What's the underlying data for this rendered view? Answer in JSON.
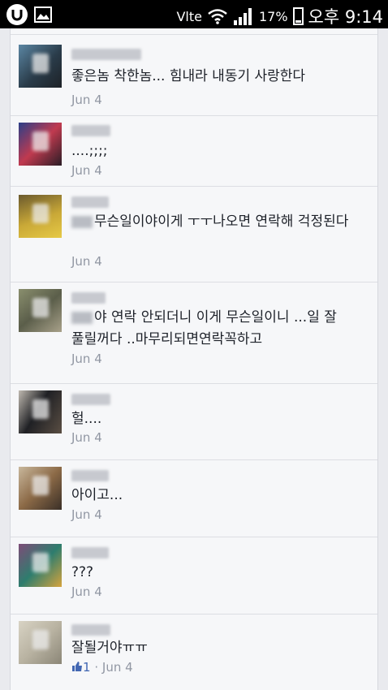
{
  "status_bar": {
    "network": "Vlte",
    "battery_percent": "17%",
    "time": "오후 9:14",
    "icons": [
      "u-plus-app-icon",
      "gallery-icon",
      "wifi-icon",
      "signal-icon",
      "battery-icon"
    ]
  },
  "comments": [
    {
      "text": "좋은놈 착한놈... 힘내라 내동기 사랑한다",
      "date": "Jun 4"
    },
    {
      "text": "....;;;;",
      "date": "Jun 4"
    },
    {
      "text": "무슨일이야이게 ㅜㅜ나오면 연락해 걱정된다",
      "date": "Jun 4"
    },
    {
      "text": "야 연락 안되더니 이게 무슨일이니 ...일 잘 풀릴꺼다 ..마무리되면연락꼭하고",
      "date": "Jun 4"
    },
    {
      "text": "헐....",
      "date": "Jun 4"
    },
    {
      "text": "아이고...",
      "date": "Jun 4"
    },
    {
      "text": "???",
      "date": "Jun 4"
    },
    {
      "text": "잘될거야ㅠㅠ",
      "date": "Jun 4",
      "likes": "1",
      "separator": "·"
    }
  ]
}
